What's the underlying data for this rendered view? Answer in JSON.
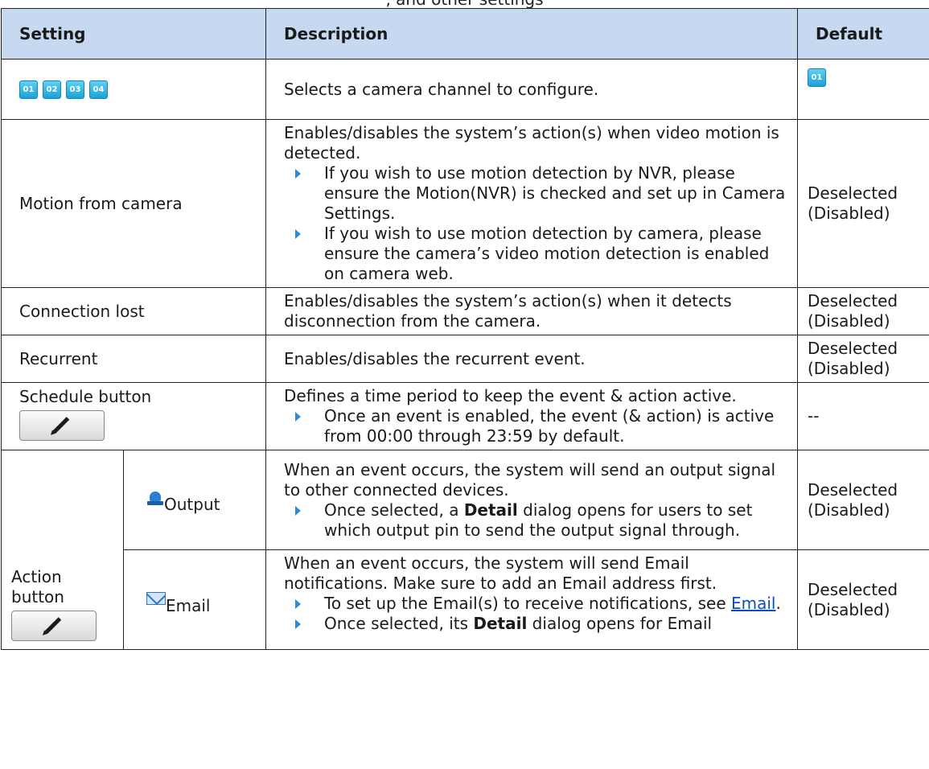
{
  "top_text": ", and other settings",
  "headers": {
    "setting": "Setting",
    "description": "Description",
    "default": "Default"
  },
  "channels": [
    "01",
    "02",
    "03",
    "04"
  ],
  "channel_default": "01",
  "rows": {
    "channel": {
      "description": "Selects a camera channel to configure."
    },
    "motion": {
      "setting": "Motion from camera",
      "description": "Enables/disables the system’s action(s) when video motion is detected.",
      "bullets": [
        "If you wish to use motion detection by NVR, please ensure the Motion(NVR) is checked and set up in Camera Settings.",
        "If you wish to use motion detection by camera, please ensure the camera’s video motion detection is enabled on camera web."
      ],
      "default_line1": "Deselected",
      "default_line2": "(Disabled)"
    },
    "connection": {
      "setting": "Connection lost",
      "description": "Enables/disables the system’s action(s) when it detects disconnection from the camera.",
      "default_line1": "Deselected",
      "default_line2": "(Disabled)"
    },
    "recurrent": {
      "setting": "Recurrent",
      "description": "Enables/disables the recurrent event.",
      "default_line1": "Deselected",
      "default_line2": "(Disabled)"
    },
    "schedule": {
      "setting": "Schedule button",
      "description": "Defines a time period to keep the event & action active.",
      "bullet": "Once an event is enabled, the event (& action) is active from 00:00 through 23:59 by default.",
      "default": "--"
    },
    "action": {
      "setting_line1": "Action",
      "setting_line2": "button",
      "output": {
        "label": "Output",
        "description": "When an event occurs, the system will send an output signal to other connected devices.",
        "bullet_pre": "Once selected, a ",
        "bullet_bold": "Detail",
        "bullet_post": " dialog opens for users to set which output pin to send the output signal through.",
        "default_line1": "Deselected",
        "default_line2": "(Disabled)"
      },
      "email": {
        "label": "Email",
        "description": "When an event occurs, the system will send Email notifications. Make sure to add an Email address first.",
        "bullet1_pre": "To set up the Email(s) to receive notifications, see ",
        "bullet1_link": "Email",
        "bullet1_post": ".",
        "bullet2_pre": "Once selected, its ",
        "bullet2_bold": "Detail",
        "bullet2_post": " dialog opens for Email",
        "default_line1": "Deselected",
        "default_line2": "(Disabled)"
      }
    }
  }
}
